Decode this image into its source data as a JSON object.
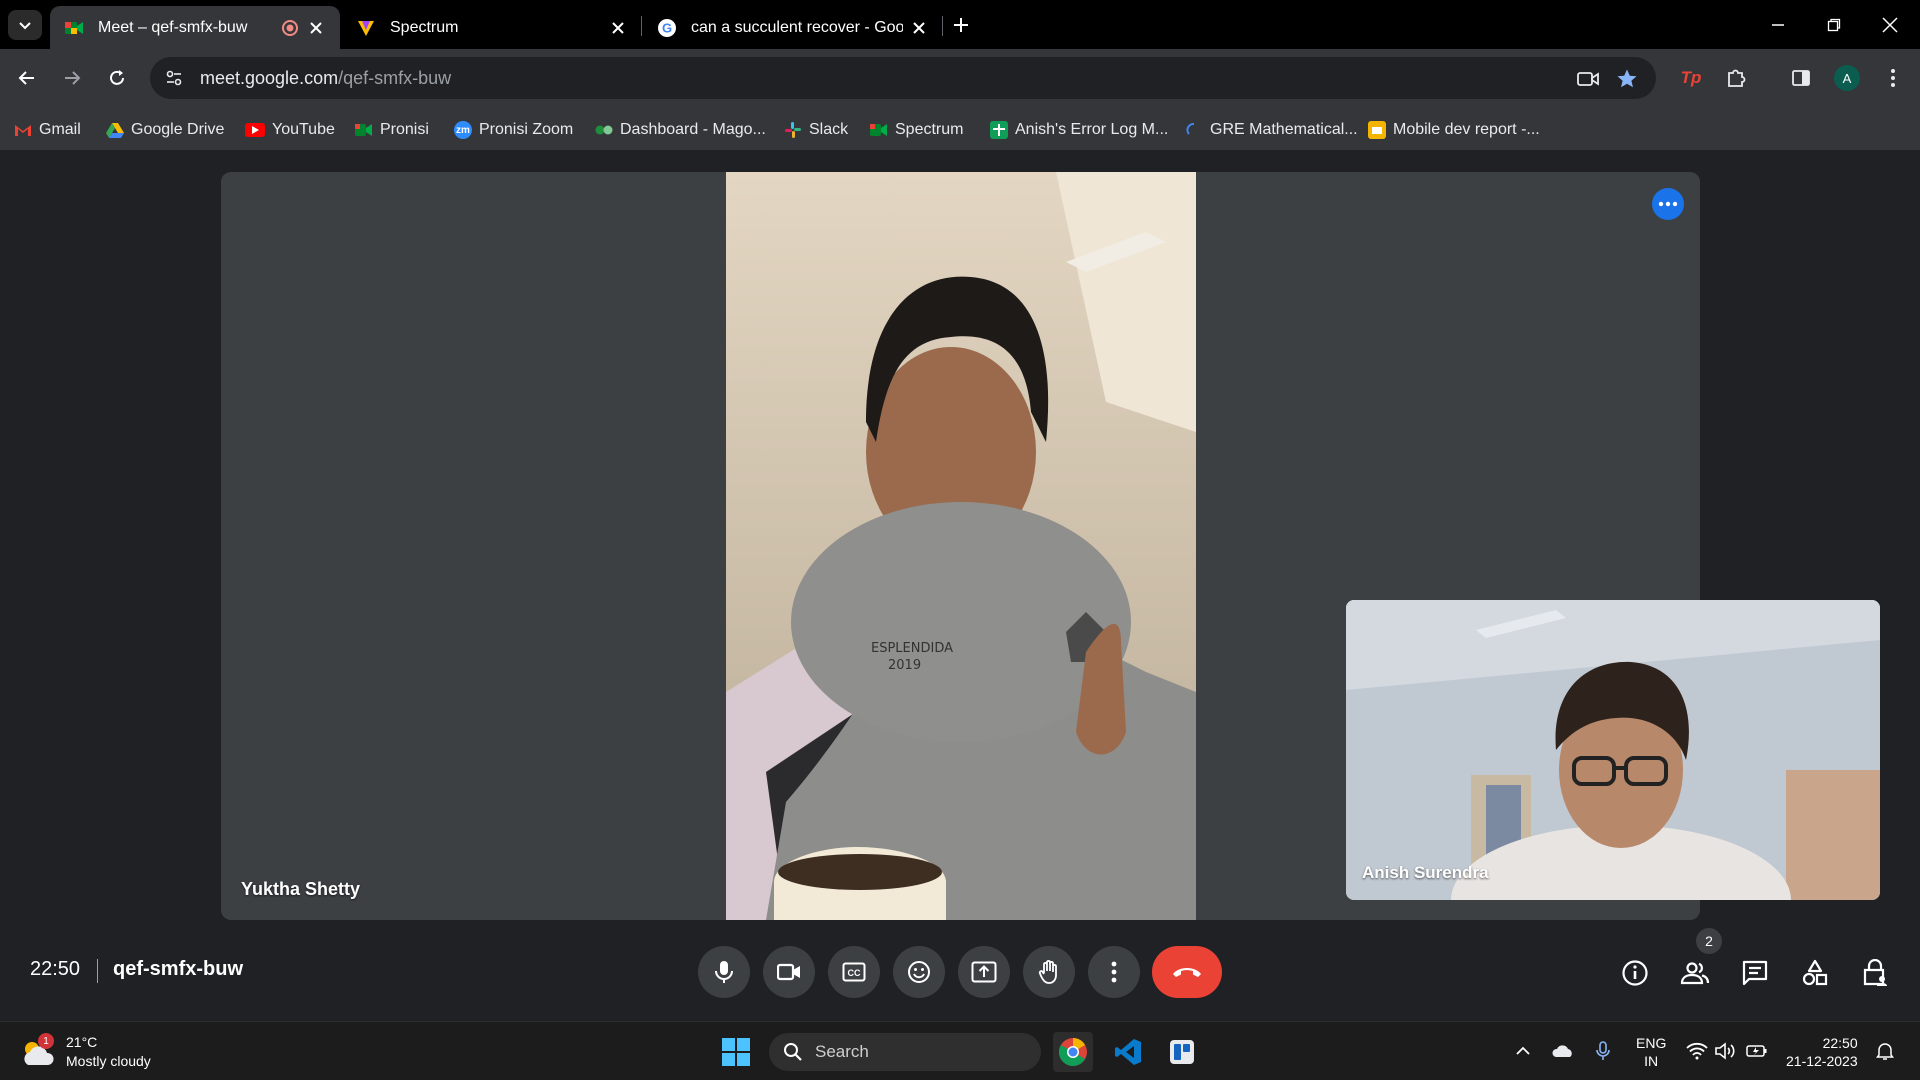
{
  "browser": {
    "tabs": [
      {
        "title": "Meet – qef-smfx-buw",
        "active": true
      },
      {
        "title": "Spectrum",
        "active": false
      },
      {
        "title": "can a succulent recover - Googl",
        "active": false
      }
    ],
    "omnibox": {
      "host": "meet.google.com",
      "path": "/qef-smfx-buw"
    },
    "profile_initial": "A",
    "bookmarks": [
      {
        "label": "Gmail",
        "icon": "gmail-icon",
        "color": "#ea4335"
      },
      {
        "label": "Google Drive",
        "icon": "drive-icon",
        "color": "#34a853"
      },
      {
        "label": "YouTube",
        "icon": "youtube-icon",
        "color": "#ff0000"
      },
      {
        "label": "Pronisi",
        "icon": "meet-icon",
        "color": "#00832d"
      },
      {
        "label": "Pronisi Zoom",
        "icon": "zoom-icon",
        "color": "#2d8cff"
      },
      {
        "label": "Dashboard - Mago...",
        "icon": "dashboard-icon",
        "color": "#1e8e3e"
      },
      {
        "label": "Slack",
        "icon": "slack-icon",
        "color": "#e01e5a"
      },
      {
        "label": "Spectrum",
        "icon": "meet-icon",
        "color": "#00832d"
      },
      {
        "label": "Anish's Error Log M...",
        "icon": "sheets-icon",
        "color": "#0f9d58"
      },
      {
        "label": "GRE Mathematical...",
        "icon": "loading-icon",
        "color": "#4285f4"
      },
      {
        "label": "Mobile dev report -...",
        "icon": "slides-icon",
        "color": "#f4b400"
      }
    ]
  },
  "meet": {
    "main_participant": "Yuktha Shetty",
    "self_participant": "Anish Surendra",
    "time": "22:50",
    "meeting_code": "qef-smfx-buw",
    "people_count": "2",
    "controls": [
      "microphone",
      "camera",
      "captions",
      "reactions",
      "present",
      "raise-hand",
      "more-options"
    ],
    "accent_color": "#1a73e8",
    "end_call_color": "#ea4335"
  },
  "taskbar": {
    "weather": {
      "temp": "21°C",
      "condition": "Mostly cloudy",
      "badge": "1"
    },
    "search_placeholder": "Search",
    "lang_line1": "ENG",
    "lang_line2": "IN",
    "time": "22:50",
    "date": "21-12-2023"
  }
}
